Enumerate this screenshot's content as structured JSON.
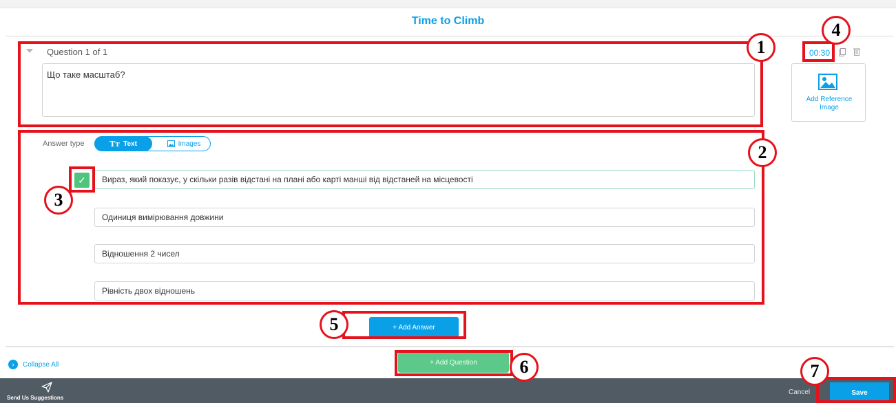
{
  "page_title": "Time to Climb",
  "question": {
    "header": "Question 1 of 1",
    "text": "Що таке масштаб?",
    "timer": "00:30",
    "reference_image_label": "Add Reference Image"
  },
  "answer_type": {
    "label": "Answer type",
    "options": [
      "Text",
      "Images"
    ],
    "selected": "Text"
  },
  "answers": [
    {
      "text": "Вираз, який показує, у скільки разів відстані на плані або карті манші від відстаней на місцевості",
      "correct": true
    },
    {
      "text": "Одиниця вимірювання довжини",
      "correct": false
    },
    {
      "text": "Відношення 2 чисел",
      "correct": false
    },
    {
      "text": "Рівність двох відношень",
      "correct": false
    }
  ],
  "buttons": {
    "add_answer": "+ Add Answer",
    "add_question": "+ Add Question",
    "collapse_all": "Collapse All",
    "send_suggestions": "Send Us Suggestions",
    "cancel": "Cancel",
    "save": "Save"
  },
  "callouts": [
    "1",
    "2",
    "3",
    "4",
    "5",
    "6",
    "7"
  ],
  "colors": {
    "accent": "#0aa0e8",
    "success": "#5cc98b",
    "annotation": "#e5121c",
    "footer": "#515b63"
  }
}
